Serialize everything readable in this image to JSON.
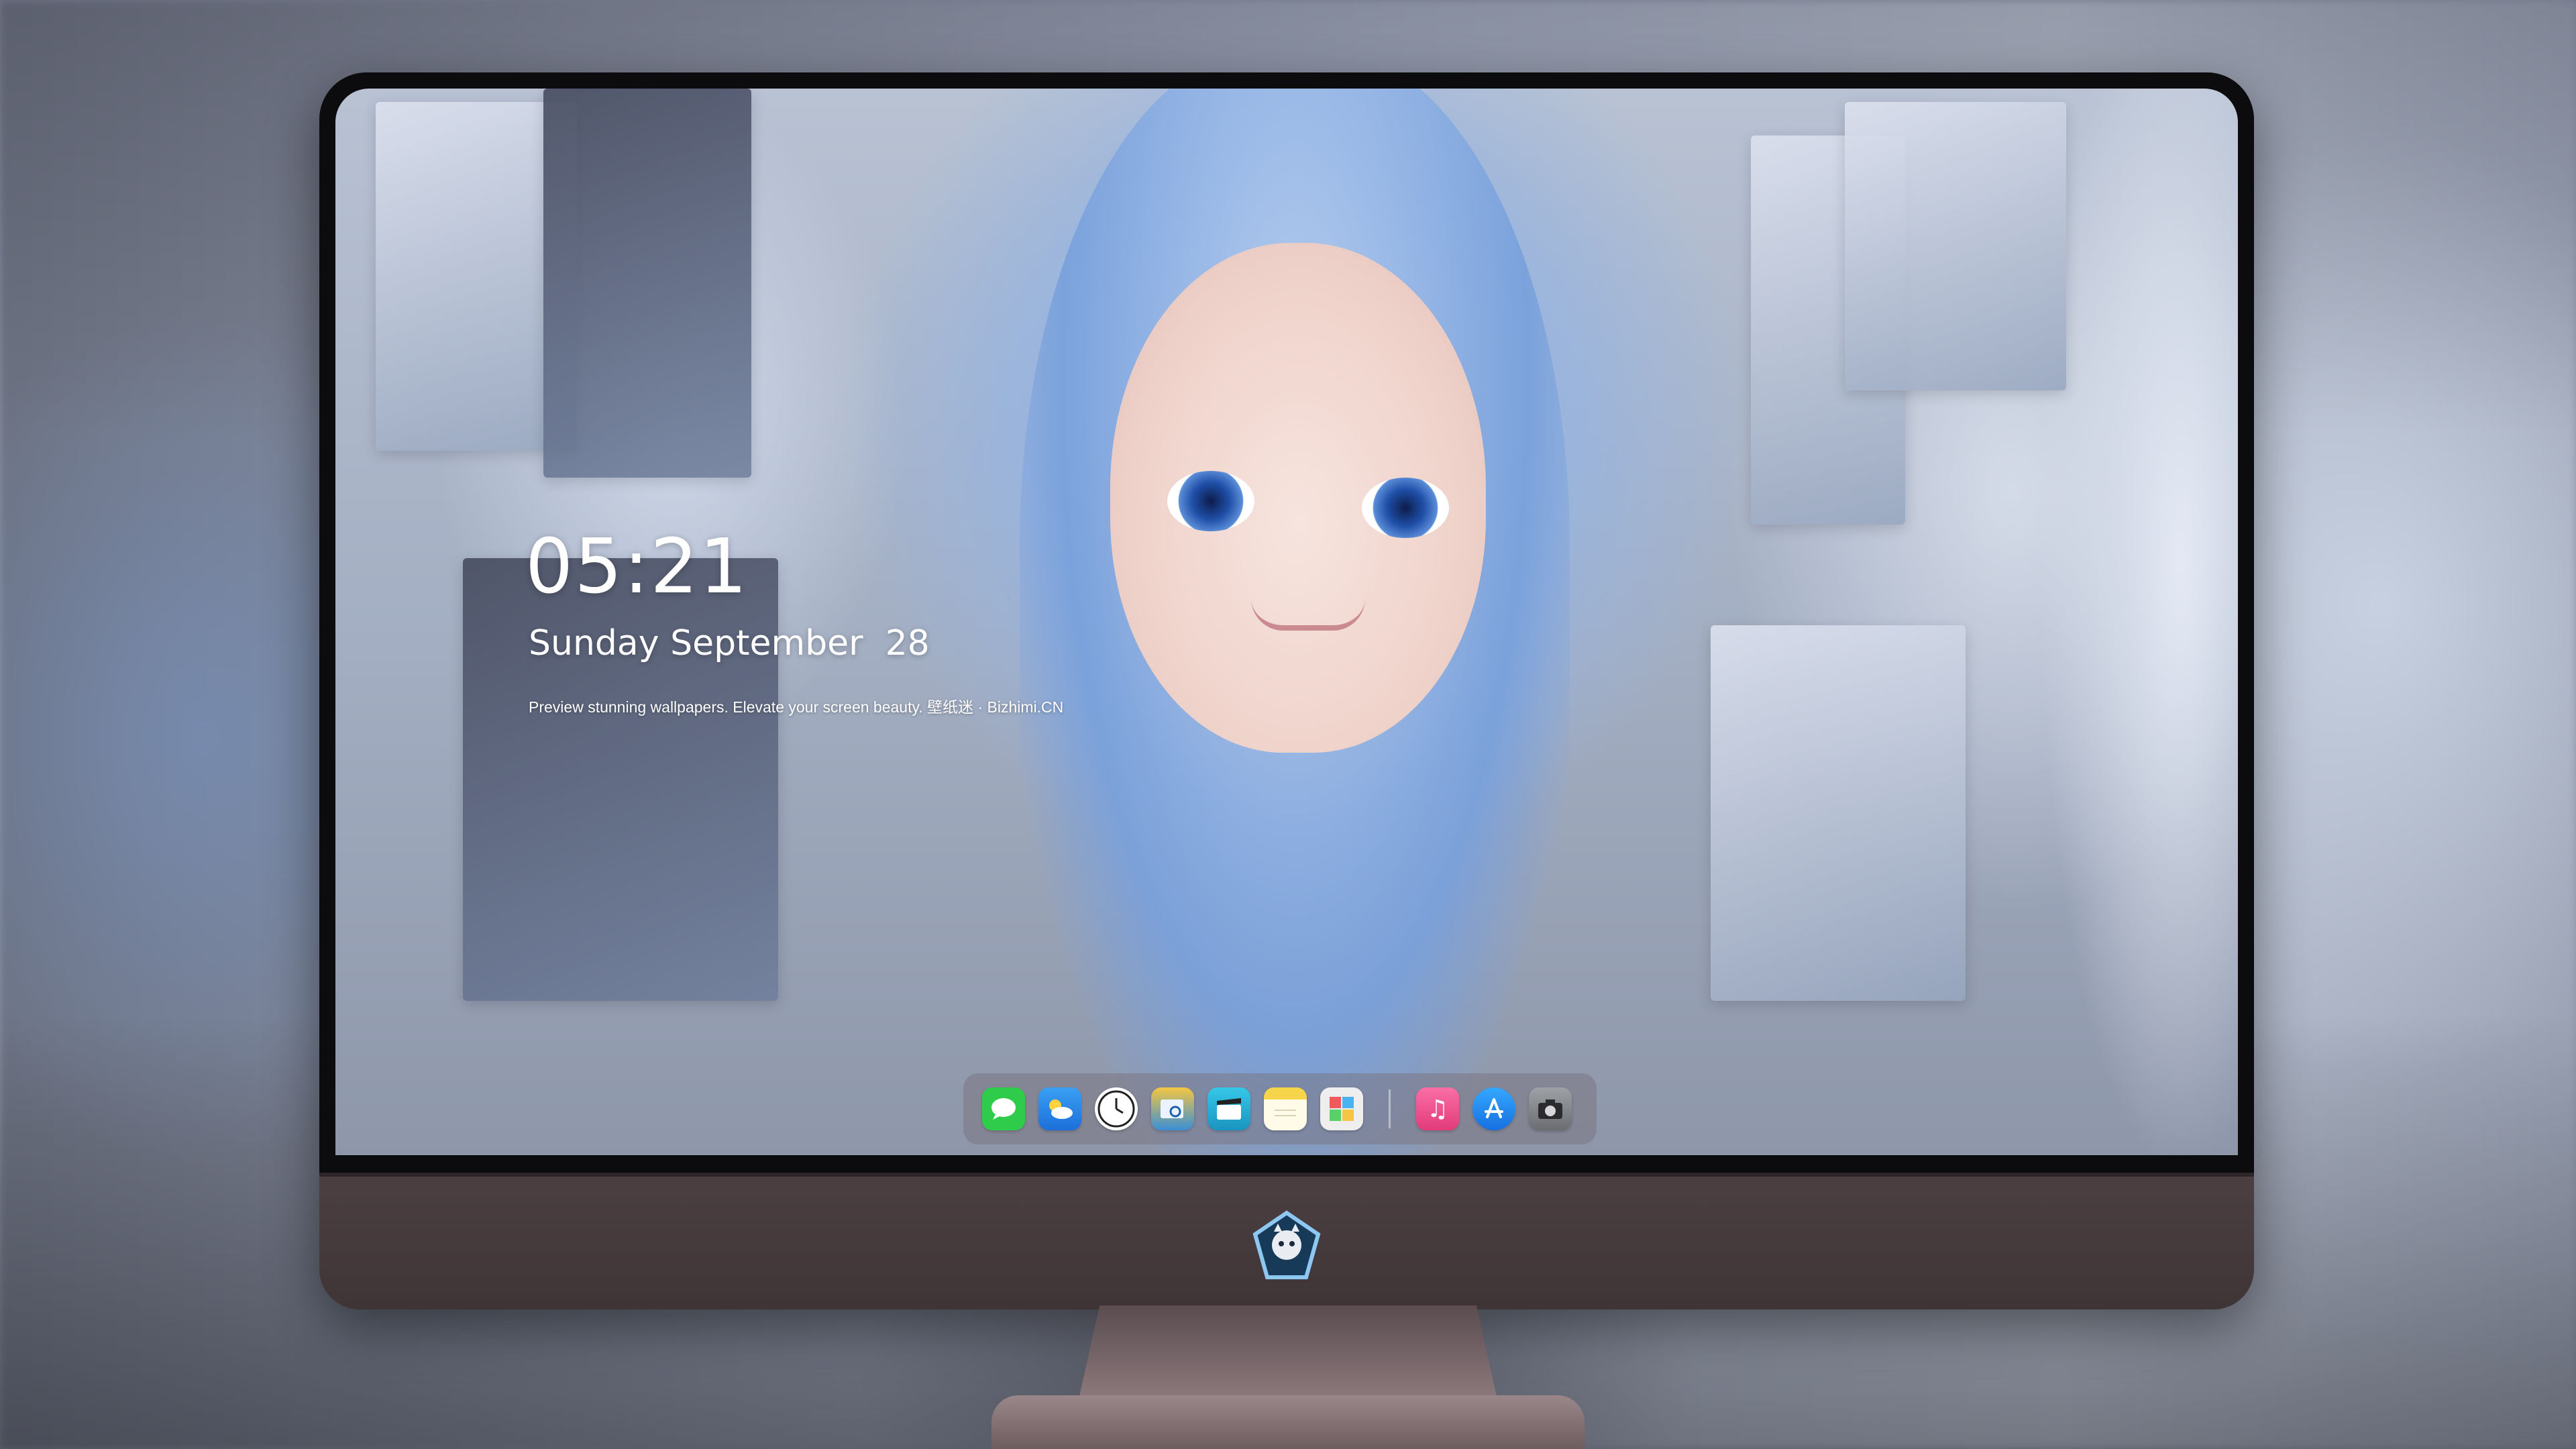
{
  "lockscreen": {
    "time": "05:21",
    "date": "Sunday September  28",
    "tagline": "Preview stunning wallpapers. Elevate your screen beauty. 壁纸迷 · Bizhimi.CN"
  },
  "dock": {
    "apps": [
      {
        "icon": "messages-icon",
        "color": "#2ecc4a"
      },
      {
        "icon": "weather-icon",
        "color": "#2f86e8"
      },
      {
        "icon": "clock-icon",
        "color": "#ffffff"
      },
      {
        "icon": "preview-icon",
        "color": "#3a8fd6"
      },
      {
        "icon": "clips-icon",
        "color": "#2ab6d8"
      },
      {
        "icon": "notes-icon",
        "color": "#f6d54a"
      },
      {
        "icon": "photo-booth-icon",
        "color": "#e8e8e8"
      }
    ],
    "pinned": [
      {
        "icon": "music-icon",
        "color": "#f04b8d"
      },
      {
        "icon": "app-store-icon",
        "color": "#1e8ef0"
      },
      {
        "icon": "camera-icon",
        "color": "#7b7d82"
      }
    ]
  },
  "brand": {
    "logo": "mascot-logo-icon"
  }
}
